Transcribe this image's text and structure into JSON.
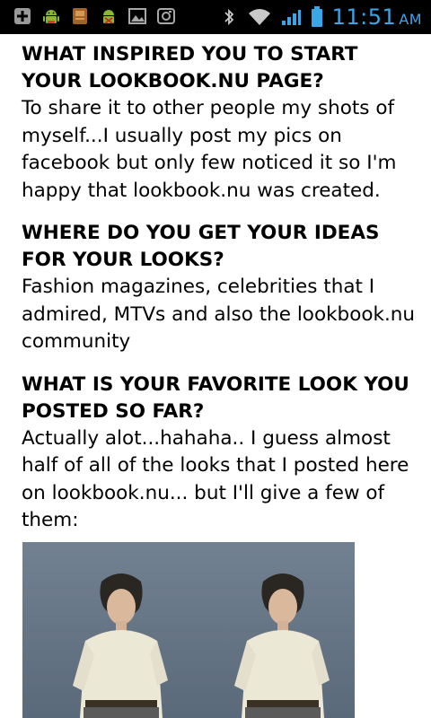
{
  "status_bar": {
    "time": "11:51",
    "ampm": "AM",
    "notification_icons": [
      "plus-box-icon",
      "android-icon",
      "app-icon",
      "android-debug-icon",
      "image-icon",
      "camera-icon"
    ],
    "system_icons": [
      "bluetooth-icon",
      "wifi-icon",
      "signal-icon",
      "battery-icon"
    ],
    "accent_color": "#3aa6e8"
  },
  "article": {
    "sections": [
      {
        "question": "WHAT INSPIRED YOU TO START YOUR LOOKBOOK.NU PAGE?",
        "answer": "To share it to other people my shots of myself...I usually post my pics on facebook but only few noticed it so I'm happy that lookbook.nu was created."
      },
      {
        "question": "WHERE DO YOU GET YOUR IDEAS FOR YOUR LOOKS?",
        "answer": "Fashion magazines, celebrities that I admired, MTVs and also the lookbook.nu community"
      },
      {
        "question": "WHAT IS YOUR FAVORITE LOOK YOU POSTED SO FAR?",
        "answer": "Actually alot...hahaha.. I guess almost half of all of the looks that I posted here on lookbook.nu... but I'll give a few  of them:"
      }
    ]
  }
}
